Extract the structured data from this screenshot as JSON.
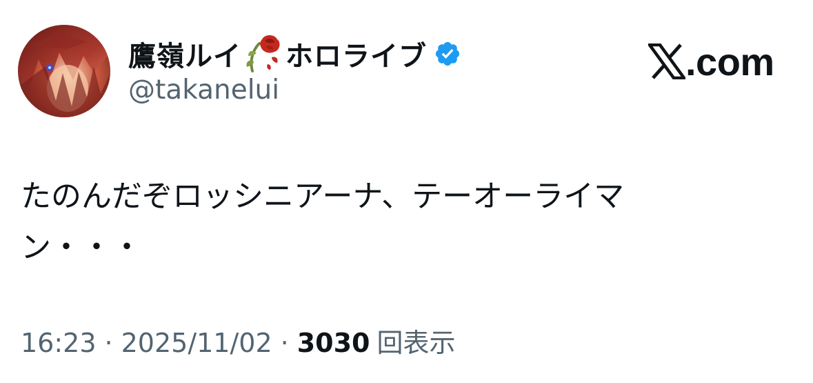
{
  "author": {
    "display_name": "鷹嶺ルイ",
    "display_name_suffix": "ホロライブ",
    "name_emoji": "wilted-rose-icon",
    "verified_icon": "verified-badge-icon",
    "handle": "@takanelui"
  },
  "brand": {
    "logo_icon": "x-logo-icon",
    "domain_text": ".com"
  },
  "tweet": {
    "lines": [
      "たのんだぞロッシニアーナ、テーオーライマ",
      "ン・・・"
    ]
  },
  "meta": {
    "time": "16:23",
    "separator": "·",
    "date": "2025/11/02",
    "views_count": "3030",
    "views_label": "回表示"
  },
  "colors": {
    "text_primary": "#0f1419",
    "text_secondary": "#536471",
    "verified_blue": "#1d9bf0"
  }
}
